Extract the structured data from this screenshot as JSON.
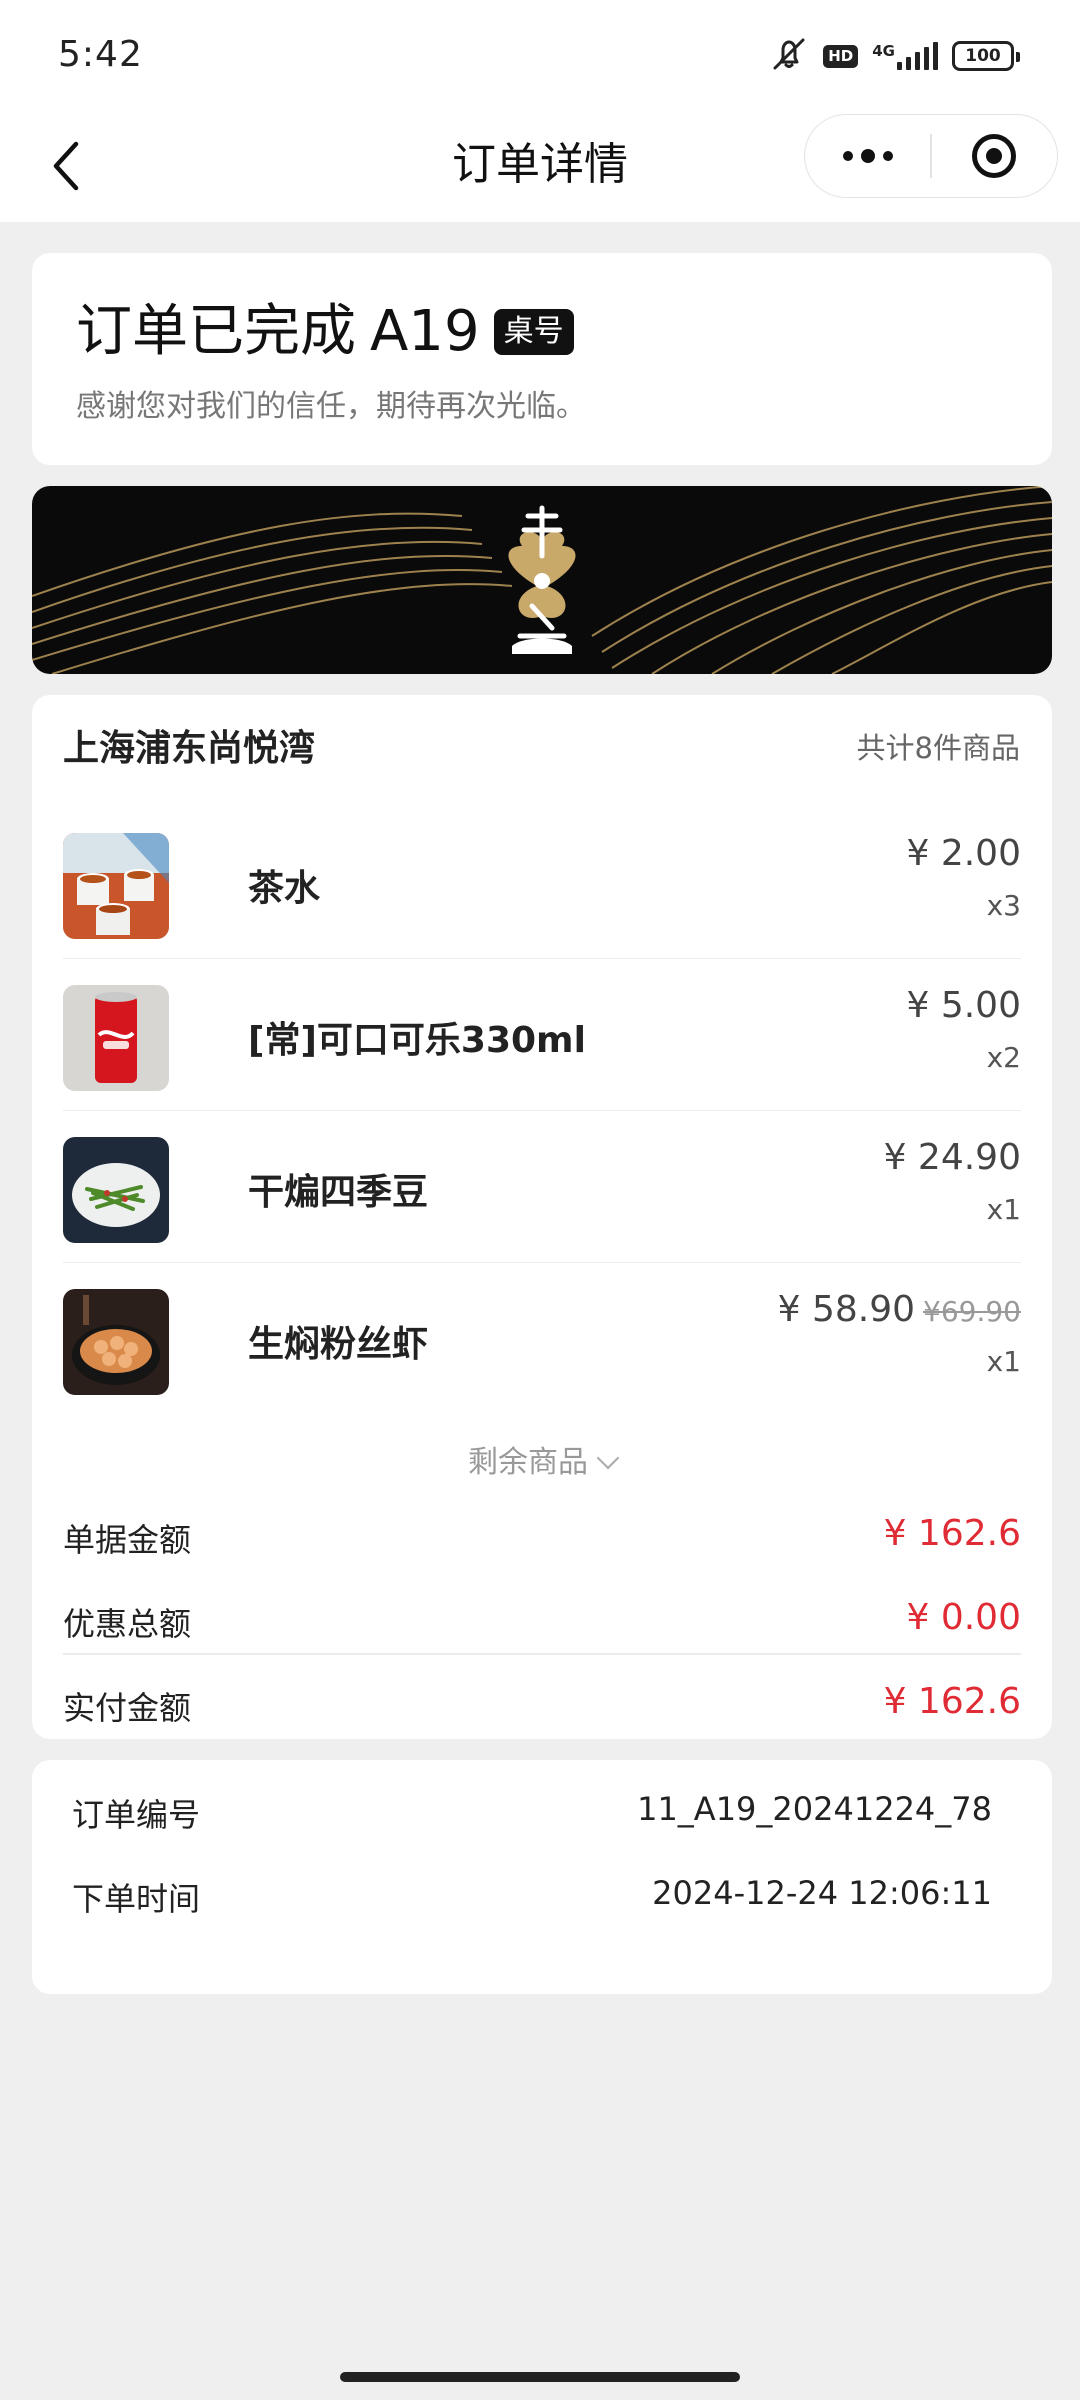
{
  "status_bar": {
    "time": "5:42",
    "hd": "HD",
    "network": "4G",
    "battery": "100",
    "icons": [
      "mute-icon",
      "hd-icon",
      "signal-icon",
      "battery-icon"
    ]
  },
  "nav": {
    "title": "订单详情",
    "back_icon": "chevron-left-icon",
    "more_icon": "more-dots-icon",
    "close_icon": "target-close-icon"
  },
  "order_status": {
    "title": "订单已完成",
    "table_no": "A19",
    "table_badge": "桌号",
    "subtitle": "感谢您对我们的信任，期待再次光临。"
  },
  "banner": {
    "brand_logo": "restaurant-logo",
    "colors": {
      "background": "#0a0a0a",
      "lines": "#b8975a"
    }
  },
  "goods": {
    "store_name": "上海浦东尚悦湾",
    "count_text": "共计8件商品",
    "items": [
      {
        "name": "茶水",
        "price": "¥ 2.00",
        "orig_price": "",
        "qty": "x3",
        "image": "tea-cups-photo"
      },
      {
        "name": "[常]可口可乐330ml",
        "price": "¥ 5.00",
        "orig_price": "",
        "qty": "x2",
        "image": "cola-can-photo"
      },
      {
        "name": "干煸四季豆",
        "price": "¥ 24.90",
        "orig_price": "",
        "qty": "x1",
        "image": "green-beans-photo"
      },
      {
        "name": "生焖粉丝虾",
        "price": "¥ 58.90",
        "orig_price": "¥69.90",
        "qty": "x1",
        "image": "shrimp-vermicelli-photo"
      }
    ],
    "more_label": "剩余商品"
  },
  "summary": {
    "rows": [
      {
        "label": "单据金额",
        "value": "¥ 162.6"
      },
      {
        "label": "优惠总额",
        "value": "¥ 0.00"
      },
      {
        "label": "实付金额",
        "value": "¥ 162.6"
      }
    ],
    "accent_color": "#e02b34"
  },
  "order_info": {
    "rows": [
      {
        "label": "订单编号",
        "value": "11_A19_20241224_78"
      },
      {
        "label": "下单时间",
        "value": "2024-12-24 12:06:11"
      }
    ]
  }
}
